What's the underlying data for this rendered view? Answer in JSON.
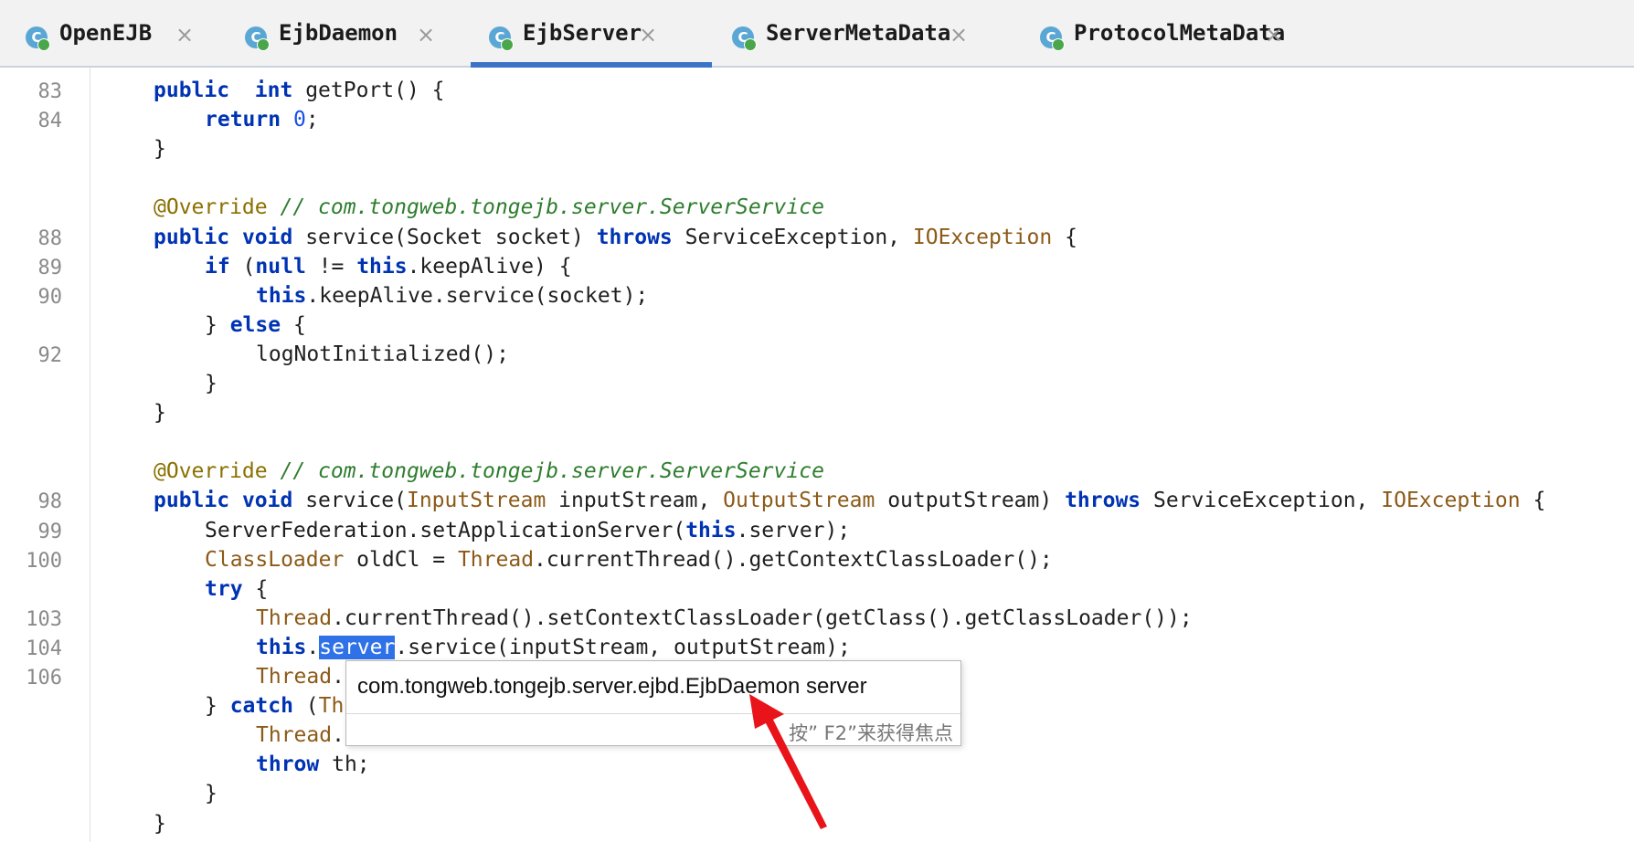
{
  "tabs": [
    {
      "label": "OpenEJB",
      "active": false
    },
    {
      "label": "EjbDaemon",
      "active": false
    },
    {
      "label": "EjbServer",
      "active": true
    },
    {
      "label": "ServerMetaData",
      "active": false
    },
    {
      "label": "ProtocolMetaData",
      "active": false
    }
  ],
  "icons": {
    "class_icon": "class-icon",
    "close_icon": "close-icon",
    "class_icon_letter": "C"
  },
  "colors": {
    "keyword": "#0033b3",
    "annotation": "#8a7000",
    "comment": "#2e7d2e",
    "type": "#8c5a18",
    "number": "#1750eb",
    "selection": "#2f71e6",
    "tab_underline": "#3b73c6"
  },
  "code": {
    "lines": [
      {
        "num": "83",
        "tokens": [
          [
            "kw",
            "public"
          ],
          [
            "",
            "  "
          ],
          [
            "kw",
            "int"
          ],
          [
            "",
            " getPort() {"
          ]
        ]
      },
      {
        "num": "84",
        "tokens": [
          [
            "kw",
            "return"
          ],
          [
            "",
            " "
          ],
          [
            "num",
            "0"
          ],
          [
            "",
            ";"
          ]
        ]
      },
      {
        "num": "",
        "tokens": [
          [
            "",
            "}"
          ]
        ]
      },
      {
        "num": "",
        "tokens": []
      },
      {
        "num": "",
        "tokens": [
          [
            "an",
            "@Override"
          ],
          [
            "",
            " "
          ],
          [
            "cm",
            "// com.tongweb.tongejb.server.ServerService"
          ]
        ]
      },
      {
        "num": "88",
        "tokens": [
          [
            "kw",
            "public"
          ],
          [
            "",
            " "
          ],
          [
            "kw",
            "void"
          ],
          [
            "",
            " service(Socket socket) "
          ],
          [
            "kw",
            "throws"
          ],
          [
            "",
            " ServiceException, "
          ],
          [
            "ty",
            "IOException"
          ],
          [
            "",
            " {"
          ]
        ]
      },
      {
        "num": "89",
        "tokens": [
          [
            "kw",
            "if"
          ],
          [
            "",
            " ("
          ],
          [
            "kw",
            "null"
          ],
          [
            "",
            " != "
          ],
          [
            "kw",
            "this"
          ],
          [
            "",
            ".keepAlive) {"
          ]
        ]
      },
      {
        "num": "90",
        "tokens": [
          [
            "kw",
            "this"
          ],
          [
            "",
            ".keepAlive.service(socket);"
          ]
        ]
      },
      {
        "num": "",
        "tokens": [
          [
            "",
            "} "
          ],
          [
            "kw",
            "else"
          ],
          [
            "",
            " {"
          ]
        ]
      },
      {
        "num": "92",
        "tokens": [
          [
            "",
            "logNotInitialized();"
          ]
        ]
      },
      {
        "num": "",
        "tokens": [
          [
            "",
            "}"
          ]
        ]
      },
      {
        "num": "",
        "tokens": [
          [
            "",
            "}"
          ]
        ]
      },
      {
        "num": "",
        "tokens": []
      },
      {
        "num": "",
        "tokens": [
          [
            "an",
            "@Override"
          ],
          [
            "",
            " "
          ],
          [
            "cm",
            "// com.tongweb.tongejb.server.ServerService"
          ]
        ]
      },
      {
        "num": "98",
        "tokens": [
          [
            "kw",
            "public"
          ],
          [
            "",
            " "
          ],
          [
            "kw",
            "void"
          ],
          [
            "",
            " service("
          ],
          [
            "ty",
            "InputStream"
          ],
          [
            "",
            " inputStream, "
          ],
          [
            "ty",
            "OutputStream"
          ],
          [
            "",
            " outputStream) "
          ],
          [
            "kw",
            "throws"
          ],
          [
            "",
            " ServiceException, "
          ],
          [
            "ty",
            "IOException"
          ],
          [
            "",
            " {"
          ]
        ]
      },
      {
        "num": "99",
        "tokens": [
          [
            "",
            "ServerFederation.setApplicationServer("
          ],
          [
            "kw",
            "this"
          ],
          [
            "",
            ".server);"
          ]
        ]
      },
      {
        "num": "100",
        "tokens": [
          [
            "ty",
            "ClassLoader"
          ],
          [
            "",
            " oldCl = "
          ],
          [
            "ty",
            "Thread"
          ],
          [
            "",
            ".currentThread().getContextClassLoader();"
          ]
        ]
      },
      {
        "num": "",
        "tokens": [
          [
            "kw",
            "try"
          ],
          [
            "",
            " {"
          ]
        ]
      },
      {
        "num": "103",
        "tokens": [
          [
            "ty",
            "Thread"
          ],
          [
            "",
            ".currentThread().setContextClassLoader(getClass().getClassLoader());"
          ]
        ]
      },
      {
        "num": "104",
        "tokens": [
          [
            "kw",
            "this"
          ],
          [
            "",
            "."
          ],
          [
            "sel",
            "server"
          ],
          [
            "",
            ".service(inputStream, outputStream);"
          ]
        ]
      },
      {
        "num": "106",
        "tokens": [
          [
            "ty",
            "Thread"
          ],
          [
            "",
            "."
          ]
        ]
      },
      {
        "num": "",
        "tokens": [
          [
            "",
            "} "
          ],
          [
            "kw",
            "catch"
          ],
          [
            "",
            " ("
          ],
          [
            "ty",
            "Th"
          ]
        ]
      },
      {
        "num": "",
        "tokens": [
          [
            "ty",
            "Thread"
          ],
          [
            "",
            "."
          ]
        ]
      },
      {
        "num": "",
        "tokens": [
          [
            "kw",
            "throw"
          ],
          [
            "",
            " th;"
          ]
        ]
      },
      {
        "num": "",
        "tokens": [
          [
            "",
            "}"
          ]
        ]
      },
      {
        "num": "",
        "tokens": [
          [
            "",
            "}"
          ]
        ]
      }
    ],
    "indents": [
      1,
      2,
      1,
      0,
      1,
      1,
      2,
      3,
      2,
      3,
      2,
      1,
      0,
      1,
      1,
      2,
      2,
      2,
      3,
      3,
      3,
      2,
      3,
      3,
      2,
      1
    ]
  },
  "tooltip": {
    "text": "com.tongweb.tongejb.server.ejbd.EjbDaemon server",
    "hint": "按” F2”来获得焦点"
  }
}
